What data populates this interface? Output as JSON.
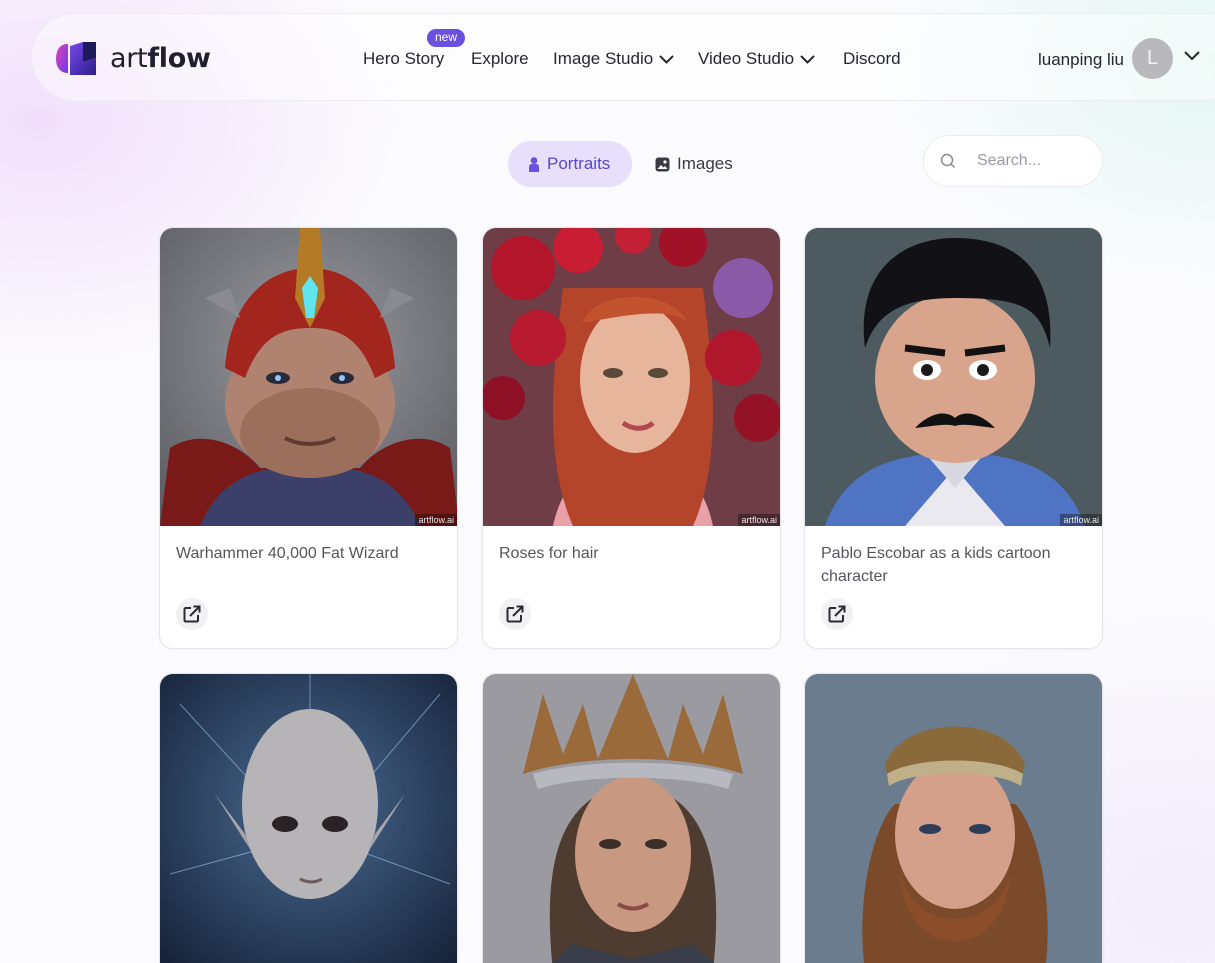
{
  "brand": {
    "name_light": "art",
    "name_bold": "flow"
  },
  "nav": {
    "hero_story": "Hero Story",
    "new_badge": "new",
    "explore": "Explore",
    "image_studio": "Image Studio",
    "video_studio": "Video Studio",
    "discord": "Discord"
  },
  "user": {
    "name": "luanping liu",
    "avatar_letter": "L"
  },
  "tabs": {
    "portraits": "Portraits",
    "images": "Images",
    "active": "Portraits"
  },
  "search": {
    "placeholder": "Search..."
  },
  "cards": [
    {
      "title": "Warhammer 40,000 Fat Wizard",
      "watermark": "artflow.ai"
    },
    {
      "title": "Roses for hair",
      "watermark": "artflow.ai"
    },
    {
      "title": "Pablo Escobar as a kids cartoon character",
      "watermark": "artflow.ai"
    },
    {
      "title": "",
      "watermark": ""
    },
    {
      "title": "",
      "watermark": ""
    },
    {
      "title": "",
      "watermark": ""
    }
  ],
  "colors": {
    "accent": "#6a4fe0",
    "active_tab_bg": "#e7dffc",
    "active_tab_text": "#5a46c9"
  },
  "icons": [
    "artflow-logo-icon",
    "chevron-down-icon",
    "person-icon",
    "image-icon",
    "search-icon",
    "share-icon"
  ]
}
